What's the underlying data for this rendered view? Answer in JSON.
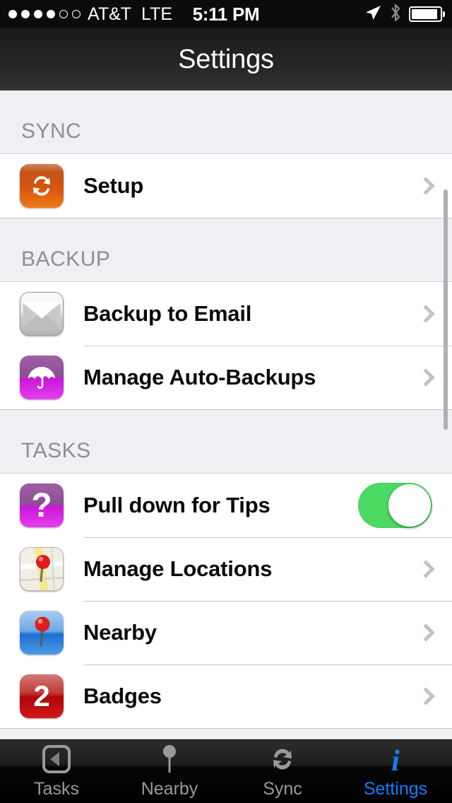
{
  "status_bar": {
    "signal_dots_filled": 4,
    "signal_dots_total": 6,
    "carrier": "AT&T",
    "network": "LTE",
    "time": "5:11 PM",
    "icons": [
      "location-arrow-icon",
      "bluetooth-icon",
      "battery-icon"
    ],
    "battery_percent": 92
  },
  "nav_bar": {
    "title": "Settings"
  },
  "sections": [
    {
      "header": "SYNC",
      "rows": [
        {
          "label": "Setup",
          "icon": "sync-refresh-icon",
          "accessory": "chevron"
        }
      ]
    },
    {
      "header": "BACKUP",
      "rows": [
        {
          "label": "Backup to Email",
          "icon": "envelope-icon",
          "accessory": "chevron"
        },
        {
          "label": "Manage Auto-Backups",
          "icon": "umbrella-icon",
          "accessory": "chevron"
        }
      ]
    },
    {
      "header": "TASKS",
      "rows": [
        {
          "label": "Pull down for Tips",
          "icon": "question-mark-icon",
          "accessory": "toggle",
          "toggle_on": true
        },
        {
          "label": "Manage Locations",
          "icon": "map-pin-icon",
          "accessory": "chevron"
        },
        {
          "label": "Nearby",
          "icon": "location-pin-icon",
          "accessory": "chevron"
        },
        {
          "label": "Badges",
          "icon": "badge-count-icon",
          "badge_value": "2",
          "accessory": "chevron"
        }
      ]
    }
  ],
  "tab_bar": {
    "items": [
      {
        "label": "Tasks",
        "icon": "back-arrow-box-icon",
        "active": false
      },
      {
        "label": "Nearby",
        "icon": "pin-icon",
        "active": false
      },
      {
        "label": "Sync",
        "icon": "refresh-icon",
        "active": false
      },
      {
        "label": "Settings",
        "icon": "info-i-icon",
        "active": true
      }
    ],
    "active_color": "#147efb",
    "inactive_color": "#9a9a9a"
  },
  "colors": {
    "toggle_on": "#4CD964",
    "group_background": "#EFEFF4",
    "row_background": "#FFFFFF",
    "separator": "#C8C7CC",
    "header_text": "#8E8E93"
  }
}
